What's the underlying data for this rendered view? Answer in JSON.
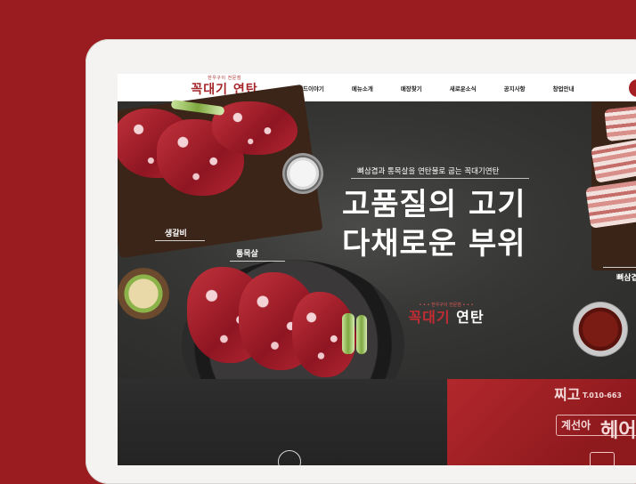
{
  "header": {
    "logo_tagline": "한우구이 전문점",
    "logo_name": "꼭대기 연탄",
    "nav": [
      "브랜드이야기",
      "메뉴소개",
      "매장찾기",
      "새로운소식",
      "공지사항",
      "창업안내"
    ]
  },
  "hero": {
    "subtitle": "뼈삼겹과 통목살을 연탄불로 굽는 꼭대기연탄",
    "title_line1": "고품질의 고기",
    "title_line2": "다채로운 부위",
    "labels": {
      "left_top": "생갈비",
      "left_mid": "통목살",
      "right": "뼈삼겹"
    },
    "stamp_tagline": "한우구이 전문점",
    "stamp_name_red": "꼭대기",
    "stamp_name_white": "연탄"
  },
  "lower_right": {
    "sign_top": "찌고",
    "sign_phone": "T.010-663",
    "sign_shop": "계선아",
    "sign_big": "헤어"
  },
  "colors": {
    "background": "#9b1c20",
    "brand_red": "#a5262a"
  }
}
